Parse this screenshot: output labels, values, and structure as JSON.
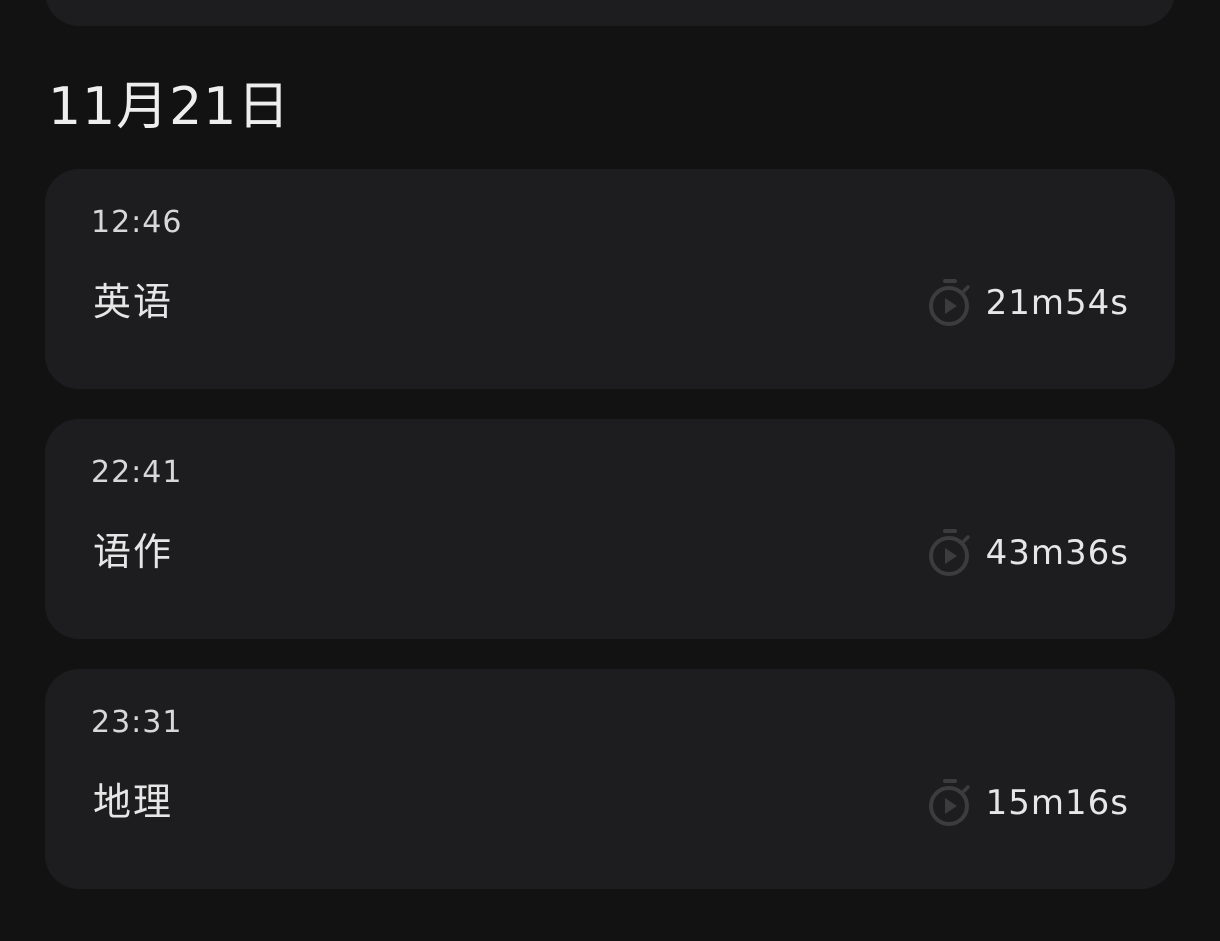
{
  "day": {
    "date": "11月21日"
  },
  "sessions": [
    {
      "time": "12:46",
      "subject": "英语",
      "duration": "21m54s"
    },
    {
      "time": "22:41",
      "subject": "语作",
      "duration": "43m36s"
    },
    {
      "time": "23:31",
      "subject": "地理",
      "duration": "15m16s"
    }
  ],
  "icons": {
    "duration": "stopwatch-play-icon"
  },
  "colors": {
    "background": "#121212",
    "card": "#1d1d1f",
    "icon": "#3c3c3e",
    "text": "#e6e6e6"
  }
}
